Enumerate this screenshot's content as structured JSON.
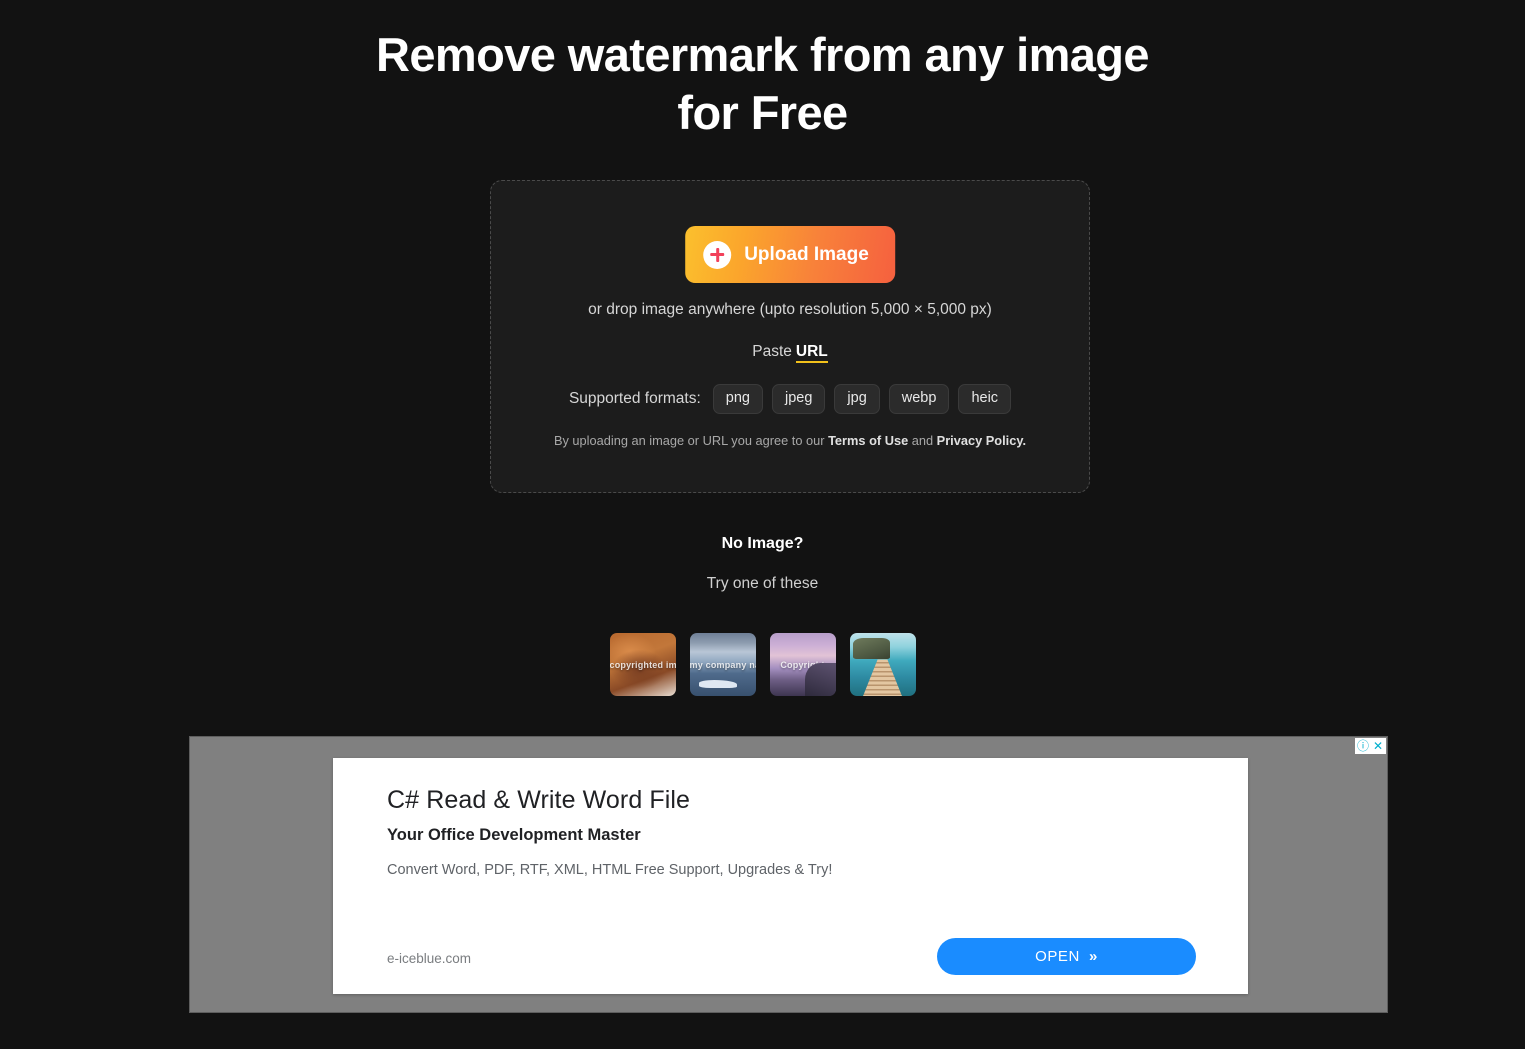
{
  "hero": {
    "title": "Remove watermark from any image for Free"
  },
  "dropzone": {
    "upload_button_label": "Upload Image",
    "plus_icon": "plus-icon",
    "drop_hint": "or drop image anywhere (upto resolution 5,000 × 5,000 px)",
    "paste_label": "Paste",
    "paste_url_link": "URL",
    "formats_label": "Supported formats:",
    "formats": [
      "png",
      "jpeg",
      "jpg",
      "webp",
      "heic"
    ],
    "terms_prefix": "By uploading an image or URL you agree to our ",
    "terms_link": "Terms of Use",
    "terms_and": " and ",
    "privacy_link": "Privacy Policy.",
    "accent_gradient_start": "#fbc02d",
    "accent_gradient_end": "#f5603f",
    "url_underline_color": "#f2c11b"
  },
  "samples": {
    "no_image_label": "No Image?",
    "try_label": "Try one of these",
    "items": [
      {
        "name": "sample-dog",
        "watermark": "copyrighted image"
      },
      {
        "name": "sample-iceberg",
        "watermark": "my company name"
      },
      {
        "name": "sample-coast",
        "watermark": "Copyright"
      },
      {
        "name": "sample-pier",
        "watermark": ""
      }
    ]
  },
  "ad": {
    "info_icon": "ⓘ",
    "close_icon": "✕",
    "headline": "C# Read & Write Word File",
    "subhead": "Your Office Development Master",
    "description": "Convert Word, PDF, RTF, XML, HTML Free Support, Upgrades & Try!",
    "domain": "e-iceblue.com",
    "cta_label": "OPEN",
    "cta_chevron": "»",
    "cta_color": "#1a8cff",
    "background_color": "#808080"
  }
}
